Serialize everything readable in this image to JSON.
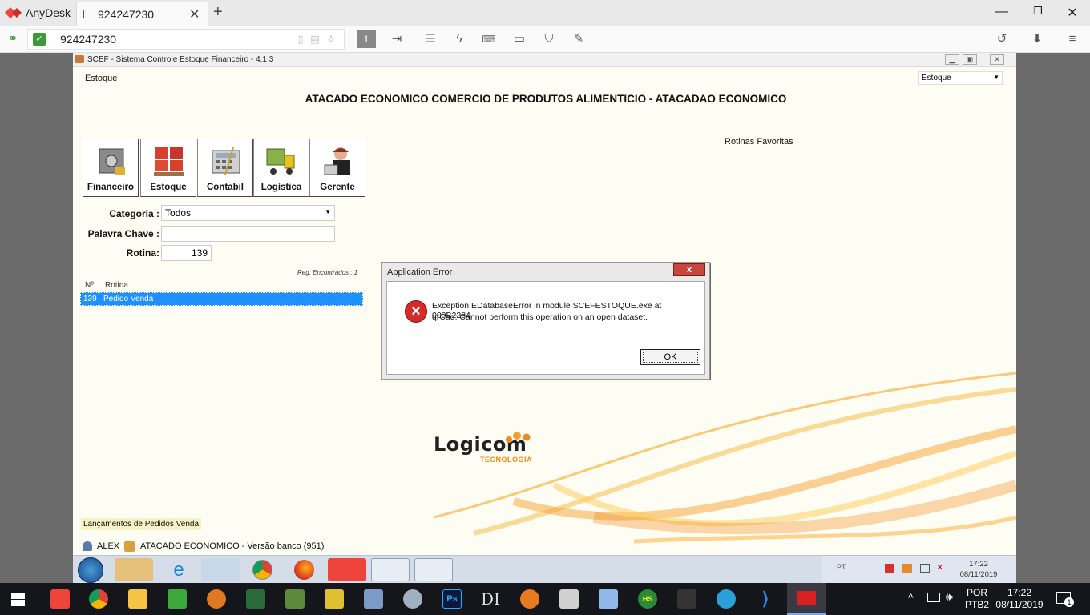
{
  "anydesk": {
    "app_name": "AnyDesk",
    "tab_label": "924247230",
    "tab_close": "✕",
    "new_tab": "+",
    "address": "924247230",
    "monitor_number": "1",
    "brand_color": "#ef443b"
  },
  "remote_window": {
    "title": "SCEF - Sistema Controle Estoque Financeiro - 4.1.3",
    "menu_estoque": "Estoque",
    "module_select": "Estoque",
    "company": "ATACADO ECONOMICO COMERCIO DE PRODUTOS ALIMENTICIO - ATACADAO ECONOMICO",
    "favorites": "Rotinas Favoritas",
    "modules": [
      "Financeiro",
      "Estoque",
      "Contabil",
      "Logística",
      "Gerente"
    ],
    "filters": {
      "categoria_label": "Categoria :",
      "categoria_value": "Todos",
      "palavra_label": "Palavra Chave :",
      "palavra_value": "",
      "rotina_label": "Rotina:",
      "rotina_value": "139"
    },
    "records_found": "Reg. Encontrados : 1",
    "grid": {
      "headers": [
        "Nº",
        "Rotina"
      ],
      "rows": [
        {
          "num": "139",
          "name": "Pedido Venda"
        }
      ]
    },
    "status_text": "Lançamentos de Pedidos Venda",
    "user": "ALEX",
    "db_info": "ATACADO ECONOMICO - Versão banco (951)",
    "logo_text": "Logicom",
    "logo_sub": "TECNOLOGIA"
  },
  "dialog": {
    "title": "Application Error",
    "close": "x",
    "message_line1": "Exception EDatabaseError in module SCEFESTOQUE.exe at 000B2284.",
    "message_line2": "qrCad: Cannot perform this operation on an open dataset.",
    "ok_label": "OK"
  },
  "remote_taskbar": {
    "tray_lang": "PT",
    "time": "17:22",
    "date": "08/11/2019"
  },
  "taskbar": {
    "lang1": "POR",
    "lang2": "PTB2",
    "time": "17:22",
    "date": "08/11/2019",
    "notifications": "1"
  }
}
